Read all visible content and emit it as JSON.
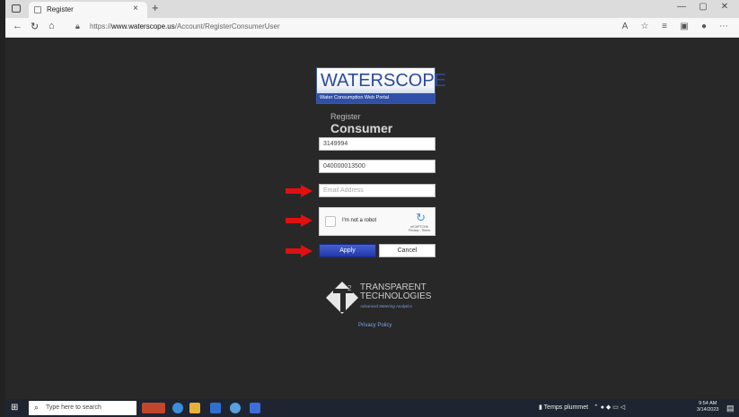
{
  "browser": {
    "tab_title": "Register",
    "tab_close": "×",
    "new_tab": "+",
    "url_prefix": "https://",
    "url_domain": "www.waterscope.us",
    "url_path": "/Account/RegisterConsumerUser",
    "window_controls": [
      "—",
      "▢",
      "✕"
    ]
  },
  "logo": {
    "word": "WATERSCOPE",
    "subtitle": "Water Consumption Web Portal"
  },
  "form": {
    "register_label": "Register",
    "title": "Consumer",
    "field1_value": "3149994",
    "field2_value": "040000013500",
    "email_placeholder": "Email Address",
    "captcha_label": "I'm not a robot",
    "captcha_brand": "reCAPTCHA",
    "captcha_links": "Privacy - Terms",
    "apply_label": "Apply",
    "cancel_label": "Cancel"
  },
  "footer": {
    "brand_line1": "TRANSPARENT",
    "brand_line2": "TECHNOLOGIES",
    "brand_tagline": "Advanced Metering Analytics",
    "privacy_link": "Privacy Policy"
  },
  "taskbar": {
    "search_placeholder": "Type here to search",
    "weather_text": "Temps plummet",
    "time": "9:54 AM",
    "date": "3/14/2023"
  },
  "colors": {
    "page_bg": "#282828",
    "apply_blue": "#2f48c0",
    "arrow_red": "#e01010",
    "link_blue": "#7ea3e8"
  }
}
